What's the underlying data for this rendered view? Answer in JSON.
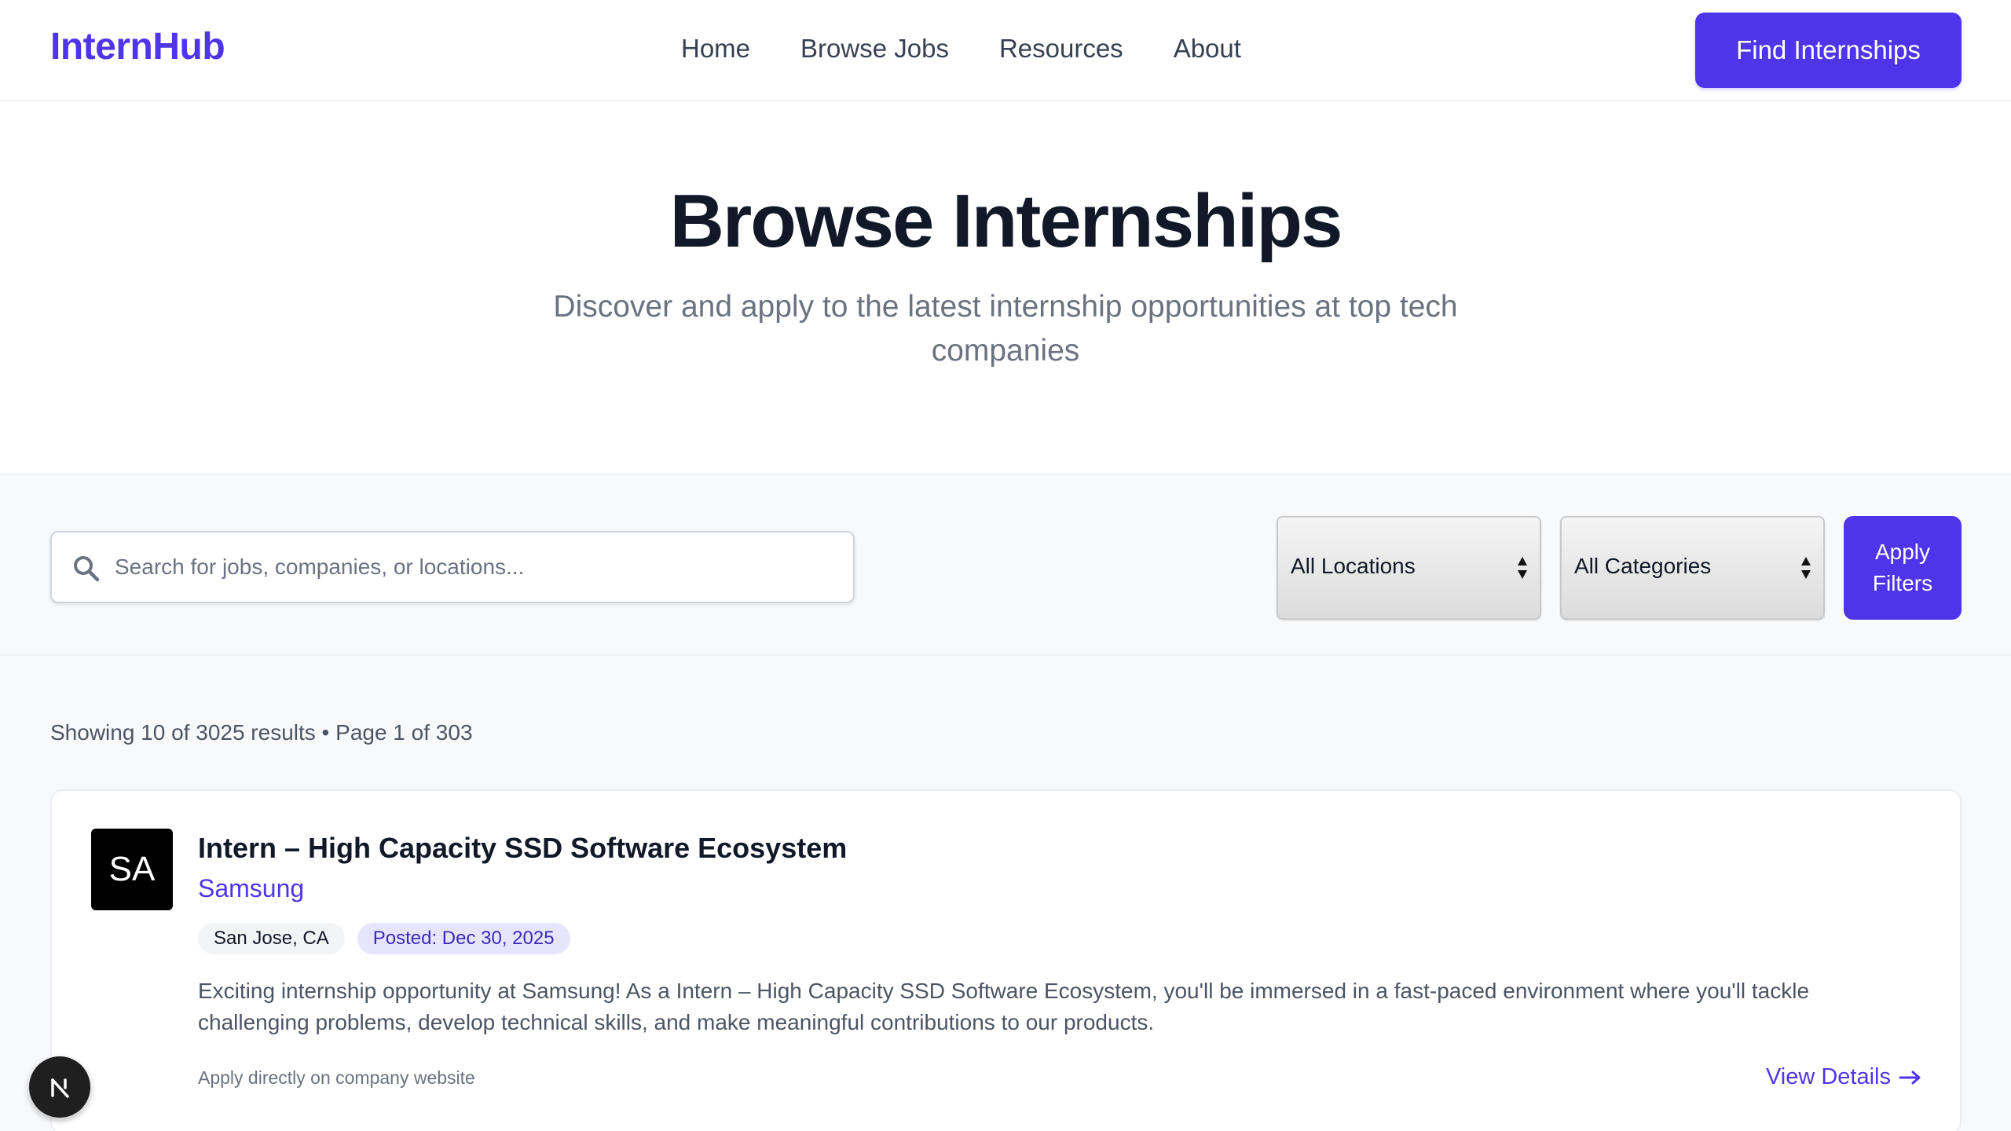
{
  "brand": {
    "name": "InternHub",
    "accent": "#4f35ea"
  },
  "nav": {
    "items": [
      {
        "label": "Home"
      },
      {
        "label": "Browse Jobs"
      },
      {
        "label": "Resources"
      },
      {
        "label": "About"
      }
    ],
    "cta_label": "Find Internships"
  },
  "hero": {
    "title": "Browse Internships",
    "subtitle": "Discover and apply to the latest internship opportunities at top tech companies"
  },
  "filters": {
    "search_placeholder": "Search for jobs, companies, or locations...",
    "search_icon": "search-icon",
    "location_selected": "All Locations",
    "category_selected": "All Categories",
    "apply_label": "Apply Filters"
  },
  "results": {
    "summary": "Showing 10 of 3025 results • Page 1 of 303",
    "jobs": [
      {
        "logo_initials": "SA",
        "title": "Intern – High Capacity SSD Software Ecosystem",
        "company": "Samsung",
        "location": "San Jose, CA",
        "posted": "Posted: Dec 30, 2025",
        "description": "Exciting internship opportunity at Samsung! As a Intern – High Capacity SSD Software Ecosystem, you'll be immersed in a fast-paced environment where you'll tackle challenging problems, develop technical skills, and make meaningful contributions to our products.",
        "apply_note": "Apply directly on company website",
        "view_details_label": "View Details"
      }
    ]
  },
  "floating_badge": {
    "icon": "next-logo-icon"
  }
}
